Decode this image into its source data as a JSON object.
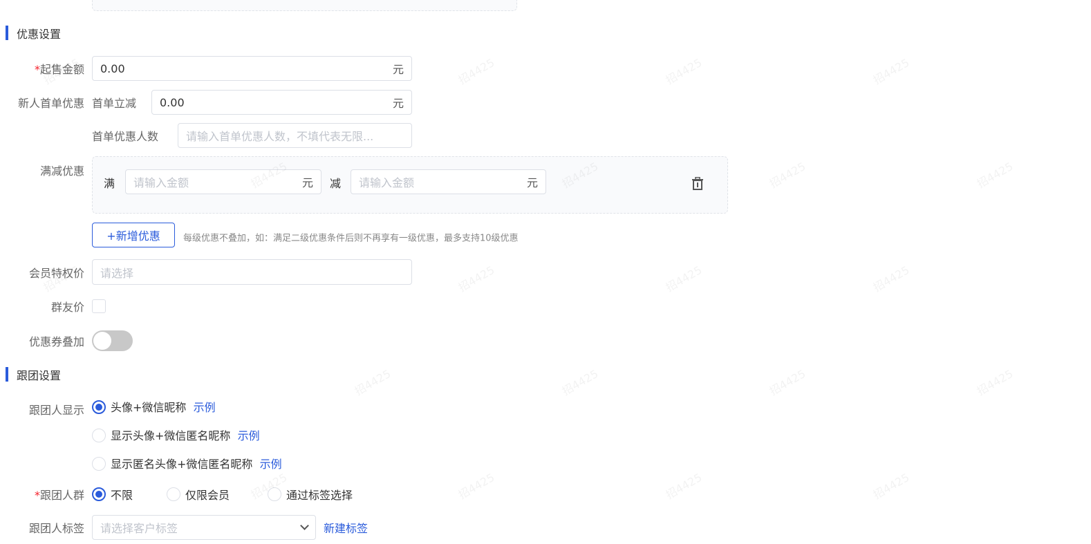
{
  "watermark": "招4425",
  "discount_section": {
    "title": "优惠设置",
    "min_amount": {
      "label": "起售金额",
      "required_mark": "*",
      "value": "0.00",
      "suffix": "元"
    },
    "new_user": {
      "label": "新人首单优惠",
      "instant_label": "首单立减",
      "instant_value": "0.00",
      "instant_suffix": "元",
      "count_label": "首单优惠人数",
      "count_placeholder": "请输入首单优惠人数，不填代表无限..."
    },
    "full_reduction": {
      "label": "满减优惠",
      "full_label": "满",
      "full_placeholder": "请输入金额",
      "full_suffix": "元",
      "reduce_label": "减",
      "reduce_placeholder": "请输入金额",
      "reduce_suffix": "元",
      "delete_icon": "trash-icon",
      "add_button": "+新增优惠",
      "hint": "每级优惠不叠加，如：满足二级优惠条件后则不再享有一级优惠，最多支持10级优惠"
    },
    "member_price": {
      "label": "会员特权价",
      "placeholder": "请选择"
    },
    "group_price": {
      "label": "群友价",
      "checked": false
    },
    "coupon_stack": {
      "label": "优惠券叠加",
      "on": false
    }
  },
  "group_section": {
    "title": "跟团设置",
    "display": {
      "label": "跟团人显示",
      "options": [
        {
          "label": "头像+微信昵称",
          "link": "示例",
          "selected": true
        },
        {
          "label": "显示头像+微信匿名昵称",
          "link": "示例",
          "selected": false
        },
        {
          "label": "显示匿名头像+微信匿名昵称",
          "link": "示例",
          "selected": false
        }
      ]
    },
    "crowd": {
      "label": "跟团人群",
      "required_mark": "*",
      "options": [
        {
          "label": "不限",
          "selected": true
        },
        {
          "label": "仅限会员",
          "selected": false
        },
        {
          "label": "通过标签选择",
          "selected": false
        }
      ]
    },
    "tags": {
      "label": "跟团人标签",
      "placeholder": "请选择客户标签",
      "new_link": "新建标签"
    }
  },
  "colors": {
    "primary": "#2a5bdb",
    "required": "#f5222d"
  }
}
